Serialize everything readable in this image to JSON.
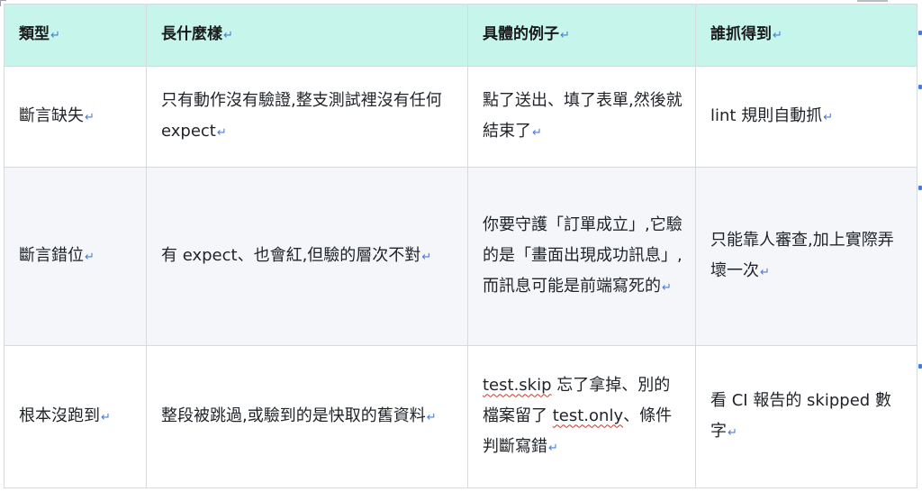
{
  "return_mark": "↵",
  "header": {
    "type": "類型",
    "appearance": "長什麼樣",
    "example": "具體的例子",
    "catcher": "誰抓得到"
  },
  "rows": [
    {
      "type": "斷言缺失",
      "appearance": "只有動作沒有驗證,整支測試裡沒有任何 expect",
      "example": "點了送出、填了表單,然後就結束了",
      "catcher": "lint 規則自動抓"
    },
    {
      "type": "斷言錯位",
      "appearance": "有 expect、也會紅,但驗的層次不對",
      "example": "你要守護「訂單成立」,它驗的是「畫面出現成功訊息」,而訊息可能是前端寫死的",
      "catcher": "只能靠人審查,加上實際弄壞一次"
    },
    {
      "type": "根本沒跑到",
      "appearance": "整段被跳過,或驗到的是快取的舊資料",
      "example_code_1": "test.skip",
      "example_part_1": " 忘了拿掉、別的檔案留了 ",
      "example_code_2": "test.only",
      "example_part_2": "、條件判斷寫錯",
      "catcher": "看 CI 報告的 skipped 數字"
    }
  ]
}
